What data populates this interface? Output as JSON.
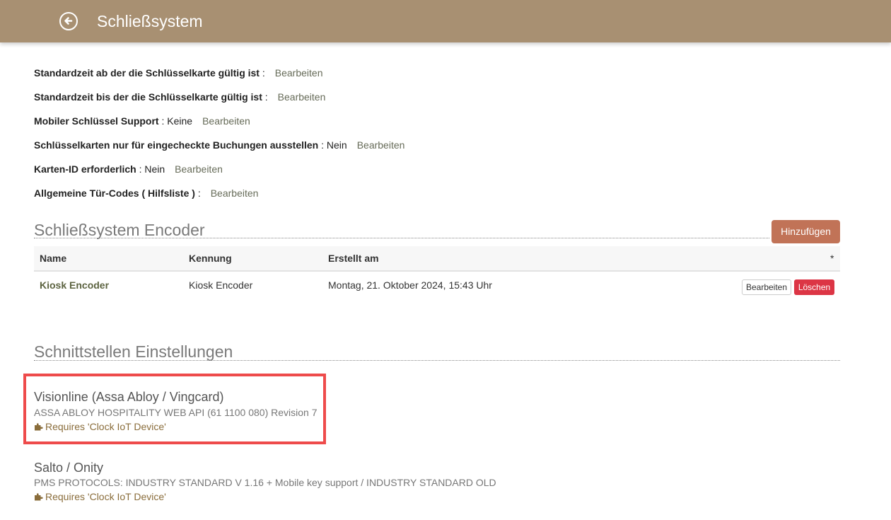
{
  "header": {
    "title": "Schließsystem",
    "back_icon": "back-circle-icon"
  },
  "settings": [
    {
      "label": "Standardzeit ab der die Schlüsselkarte gültig ist",
      "sep": " :",
      "value": "",
      "edit": "Bearbeiten"
    },
    {
      "label": "Standardzeit bis der die Schlüsselkarte gültig ist",
      "sep": " :",
      "value": "",
      "edit": "Bearbeiten"
    },
    {
      "label": "Mobiler Schlüssel Support",
      "sep": " :",
      "value": " Keine",
      "edit": "Bearbeiten"
    },
    {
      "label": "Schlüsselkarten nur für eingecheckte Buchungen ausstellen",
      "sep": " :",
      "value": " Nein",
      "edit": "Bearbeiten"
    },
    {
      "label": "Karten-ID erforderlich",
      "sep": " :",
      "value": " Nein",
      "edit": "Bearbeiten"
    },
    {
      "label": "Allgemeine Tür-Codes ( Hilfsliste )",
      "sep": " :",
      "value": "",
      "edit": "Bearbeiten"
    }
  ],
  "encoder_section": {
    "title": "Schließsystem Encoder",
    "add_label": "Hinzufügen",
    "columns": [
      "Name",
      "Kennung",
      "Erstellt am",
      "*"
    ],
    "rows": [
      {
        "name": "Kiosk Encoder",
        "kennung": "Kiosk Encoder",
        "created": "Montag, 21. Oktober 2024, 15:43 Uhr",
        "edit": "Bearbeiten",
        "delete": "Löschen"
      }
    ]
  },
  "interfaces_section": {
    "title": "Schnittstellen Einstellungen",
    "items": [
      {
        "title": "Visionline (Assa Abloy / Vingcard)",
        "subtitle": "ASSA ABLOY HOSPITALITY WEB API (61 1100 080) Revision 7",
        "requirement": "Requires 'Clock IoT Device'",
        "req_icon": "puzzle-icon"
      },
      {
        "title": "Salto / Onity",
        "subtitle": "PMS PROTOCOLS: INDUSTRY STANDARD V 1.16 + Mobile key support / INDUSTRY STANDARD OLD",
        "requirement": "Requires 'Clock IoT Device'",
        "req_icon": "puzzle-icon"
      }
    ]
  },
  "colors": {
    "header": "#a89072",
    "add_button": "#c17357",
    "delete_button": "#dc3545",
    "highlight": "#ee4b4b"
  }
}
